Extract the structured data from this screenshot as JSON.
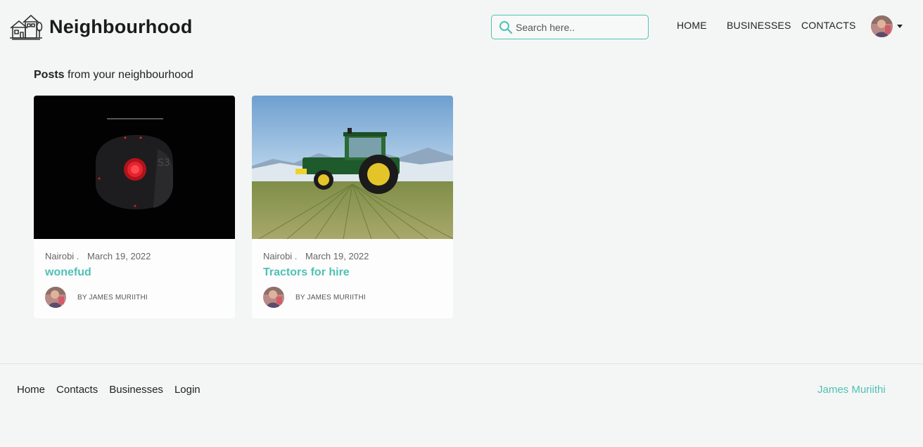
{
  "brand": {
    "name": "Neighbourhood",
    "logo_icon": "house-logo-icon"
  },
  "search": {
    "placeholder": "Search here..",
    "icon": "search-icon"
  },
  "nav": {
    "home": "HOME",
    "businesses": "BUSINESSES",
    "contacts": "CONTACTS"
  },
  "section": {
    "title_bold": "Posts",
    "title_rest": " from your neighbourhood"
  },
  "posts": [
    {
      "location": "Nairobi .",
      "date": "March 19, 2022",
      "title": "wonefud",
      "author": "BY JAMES MURIITHI"
    },
    {
      "location": "Nairobi .",
      "date": "March 19, 2022",
      "title": "Tractors for hire",
      "author": "BY JAMES MURIITHI"
    }
  ],
  "footer": {
    "links": [
      "Home",
      "Contacts",
      "Businesses",
      "Login"
    ],
    "author": "James Muriithi"
  },
  "colors": {
    "accent": "#4fc1b5",
    "background": "#f4f6f5"
  }
}
